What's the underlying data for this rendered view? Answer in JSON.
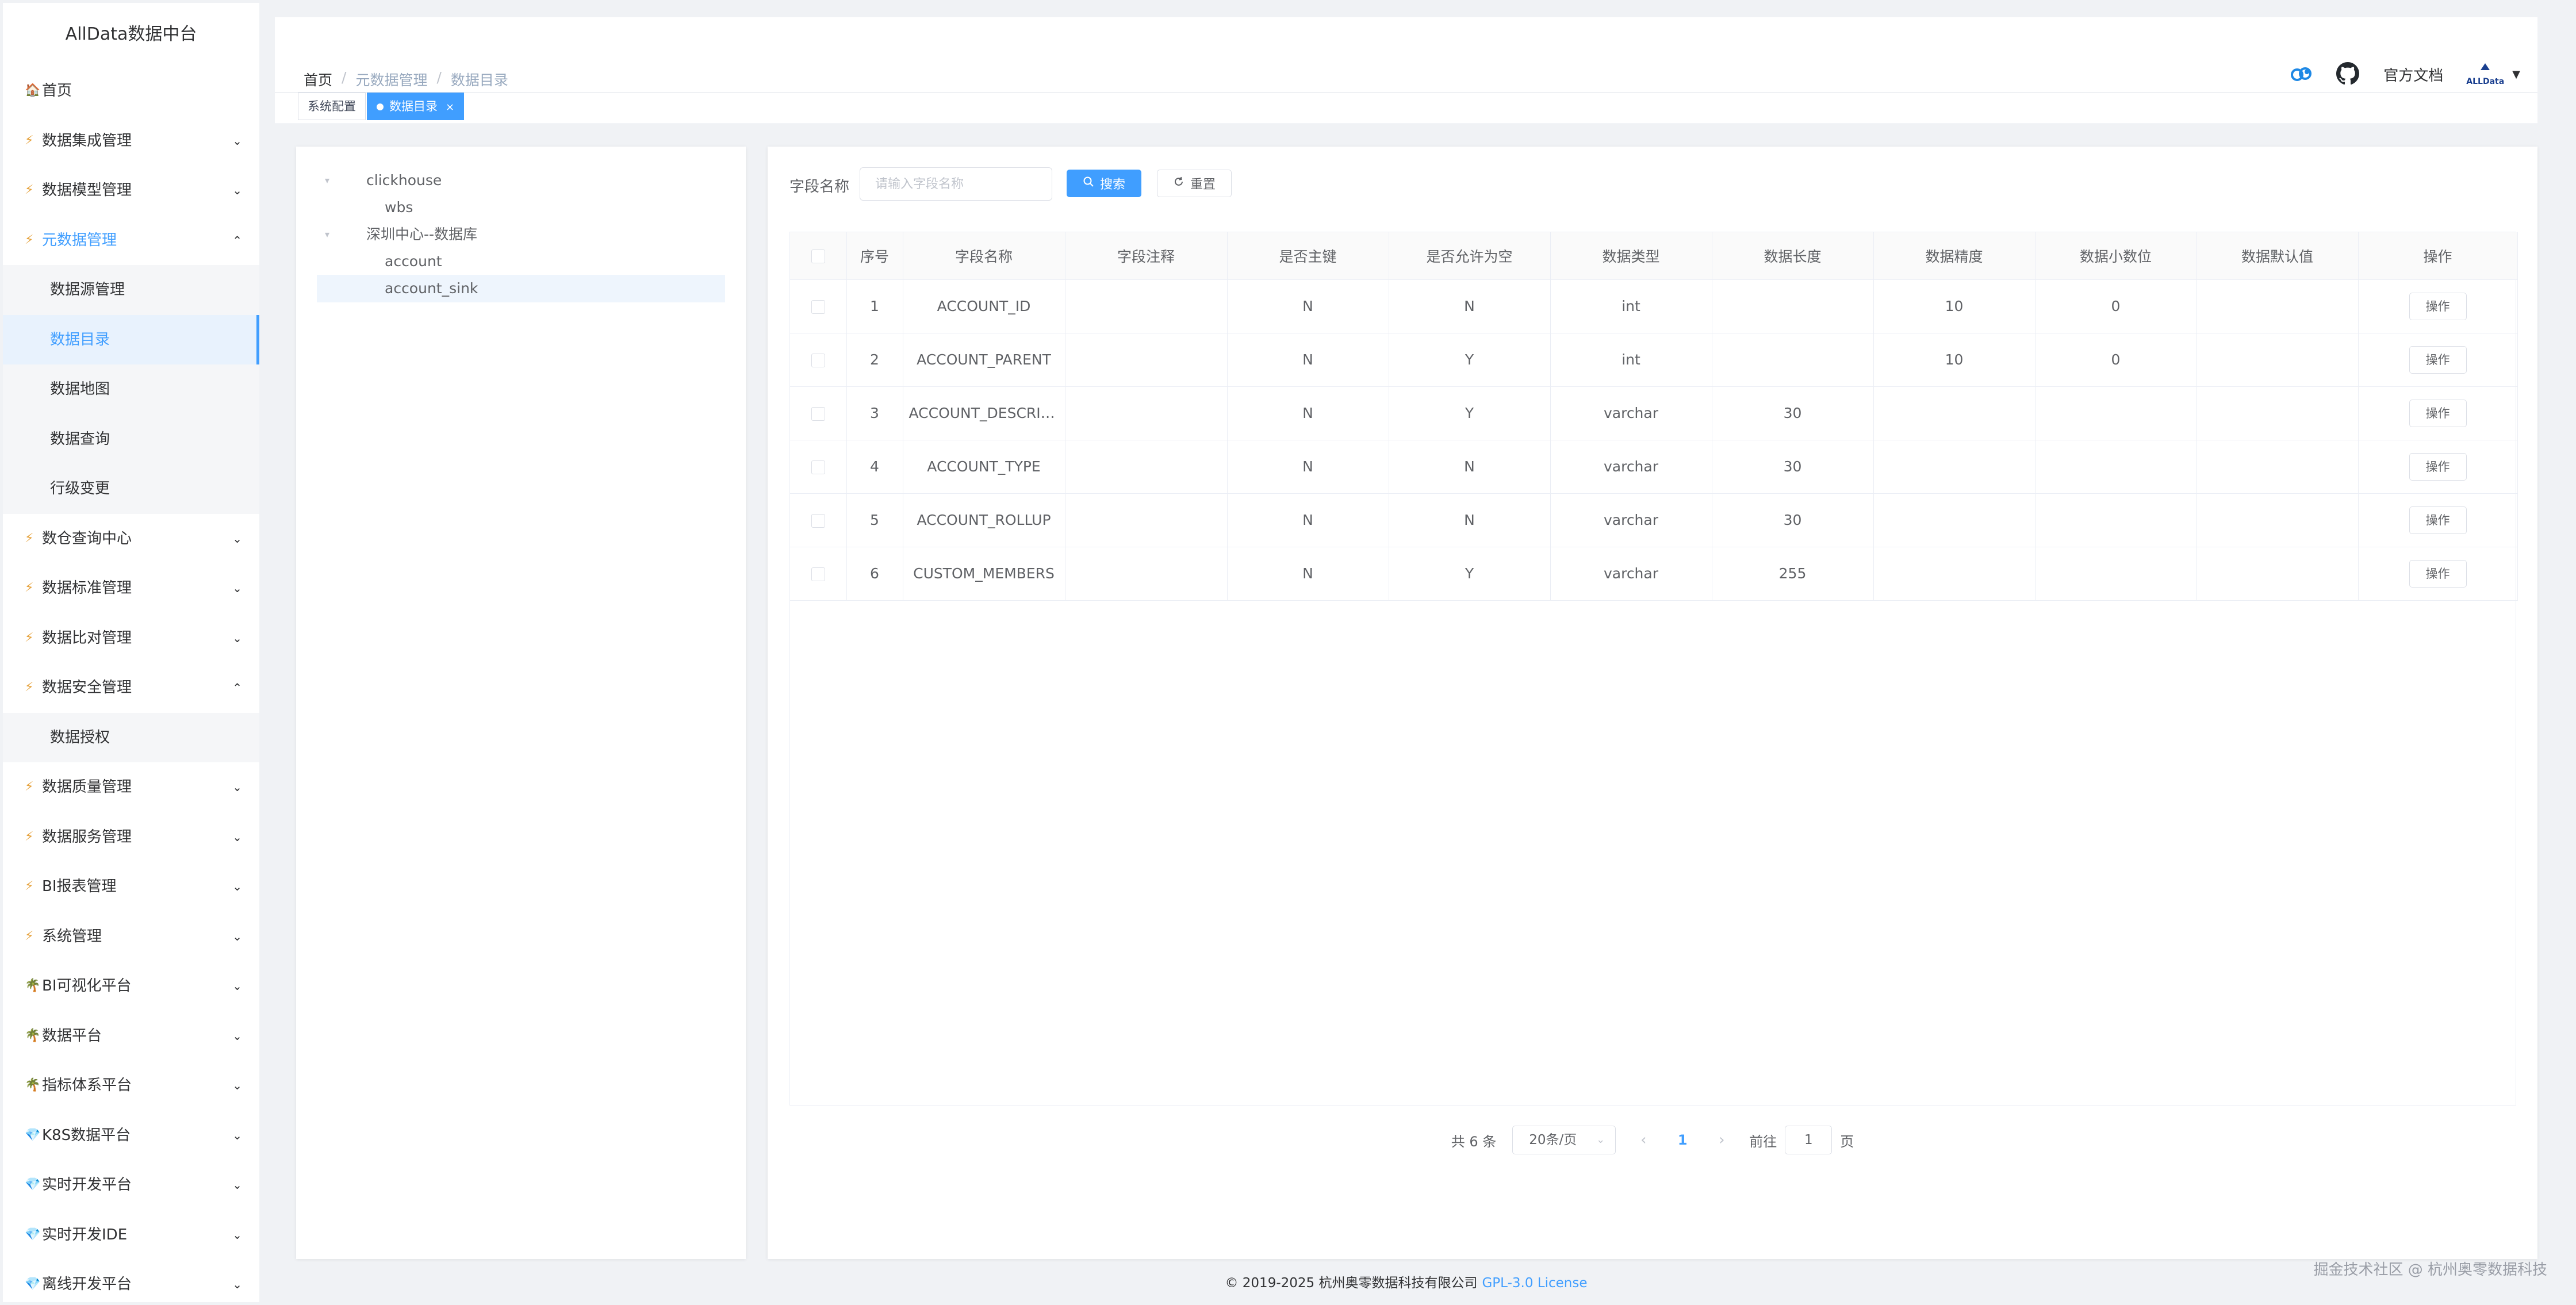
{
  "app": {
    "title": "AllData数据中台"
  },
  "sidebar": {
    "items": [
      {
        "label": "首页",
        "icon": "home-icon",
        "expandable": false
      },
      {
        "label": "数据集成管理",
        "icon": "bolt-icon",
        "expandable": true,
        "expanded": false
      },
      {
        "label": "数据模型管理",
        "icon": "bolt-icon",
        "expandable": true,
        "expanded": false
      },
      {
        "label": "元数据管理",
        "icon": "bolt-icon",
        "expandable": true,
        "expanded": true,
        "children": [
          "数据源管理",
          "数据目录",
          "数据地图",
          "数据查询",
          "行级变更"
        ]
      },
      {
        "label": "数仓查询中心",
        "icon": "bolt-icon",
        "expandable": true,
        "expanded": false
      },
      {
        "label": "数据标准管理",
        "icon": "bolt-icon",
        "expandable": true,
        "expanded": false
      },
      {
        "label": "数据比对管理",
        "icon": "bolt-icon",
        "expandable": true,
        "expanded": false
      },
      {
        "label": "数据安全管理",
        "icon": "bolt-icon",
        "expandable": true,
        "expanded": true,
        "children": [
          "数据授权"
        ]
      },
      {
        "label": "数据质量管理",
        "icon": "bolt-icon",
        "expandable": true,
        "expanded": false
      },
      {
        "label": "数据服务管理",
        "icon": "bolt-icon",
        "expandable": true,
        "expanded": false
      },
      {
        "label": "BI报表管理",
        "icon": "bolt-icon",
        "expandable": true,
        "expanded": false
      },
      {
        "label": "系统管理",
        "icon": "bolt-icon",
        "expandable": true,
        "expanded": false
      },
      {
        "label": "BI可视化平台",
        "icon": "palm-tree-icon",
        "expandable": true,
        "expanded": false
      },
      {
        "label": "数据平台",
        "icon": "palm-tree-icon",
        "expandable": true,
        "expanded": false
      },
      {
        "label": "指标体系平台",
        "icon": "palm-tree-icon",
        "expandable": true,
        "expanded": false
      },
      {
        "label": "K8S数据平台",
        "icon": "gem-icon",
        "expandable": true,
        "expanded": false
      },
      {
        "label": "实时开发平台",
        "icon": "gem-icon",
        "expandable": true,
        "expanded": false
      },
      {
        "label": "实时开发IDE",
        "icon": "gem-icon",
        "expandable": true,
        "expanded": false
      },
      {
        "label": "离线开发平台",
        "icon": "gem-icon",
        "expandable": true,
        "expanded": false
      }
    ],
    "active_parent": "元数据管理",
    "active_child": "数据目录"
  },
  "header": {
    "breadcrumb": [
      "首页",
      "元数据管理",
      "数据目录"
    ],
    "docs_label": "官方文档",
    "avatar_text": "ALLData"
  },
  "tags": [
    {
      "label": "系统配置",
      "active": false
    },
    {
      "label": "数据目录",
      "active": true,
      "closable": true
    }
  ],
  "tree": {
    "nodes": [
      {
        "label": "clickhouse",
        "level": 0,
        "expanded": true
      },
      {
        "label": "wbs",
        "level": 1
      },
      {
        "label": "深圳中心--数据库",
        "level": 0,
        "expanded": true
      },
      {
        "label": "account",
        "level": 1
      },
      {
        "label": "account_sink",
        "level": 1,
        "selected": true
      }
    ]
  },
  "filter": {
    "label": "字段名称",
    "placeholder": "请输入字段名称",
    "search_label": "搜索",
    "reset_label": "重置"
  },
  "table": {
    "columns": [
      "序号",
      "字段名称",
      "字段注释",
      "是否主键",
      "是否允许为空",
      "数据类型",
      "数据长度",
      "数据精度",
      "数据小数位",
      "数据默认值",
      "操作"
    ],
    "rows": [
      [
        "1",
        "ACCOUNT_ID",
        "",
        "N",
        "N",
        "int",
        "",
        "10",
        "0",
        ""
      ],
      [
        "2",
        "ACCOUNT_PARENT",
        "",
        "N",
        "Y",
        "int",
        "",
        "10",
        "0",
        ""
      ],
      [
        "3",
        "ACCOUNT_DESCRIPTION",
        "",
        "N",
        "Y",
        "varchar",
        "30",
        "",
        "",
        ""
      ],
      [
        "4",
        "ACCOUNT_TYPE",
        "",
        "N",
        "N",
        "varchar",
        "30",
        "",
        "",
        ""
      ],
      [
        "5",
        "ACCOUNT_ROLLUP",
        "",
        "N",
        "N",
        "varchar",
        "30",
        "",
        "",
        ""
      ],
      [
        "6",
        "CUSTOM_MEMBERS",
        "",
        "N",
        "Y",
        "varchar",
        "255",
        "",
        "",
        ""
      ]
    ],
    "action_label": "操作"
  },
  "pagination": {
    "total_text": "共 6 条",
    "page_size": "20条/页",
    "current_page": "1",
    "goto_prefix": "前往",
    "goto_value": "1",
    "goto_suffix": "页"
  },
  "footer": {
    "copyright": "© 2019-2025 杭州奥零数据科技有限公司",
    "license": "GPL-3.0 License"
  },
  "watermark": "掘金技术社区 @ 杭州奥零数据科技",
  "colors": {
    "accent": "#409eff",
    "bolt": "#e6a23c",
    "sidebar_active_bg": "#e8f2fd"
  }
}
